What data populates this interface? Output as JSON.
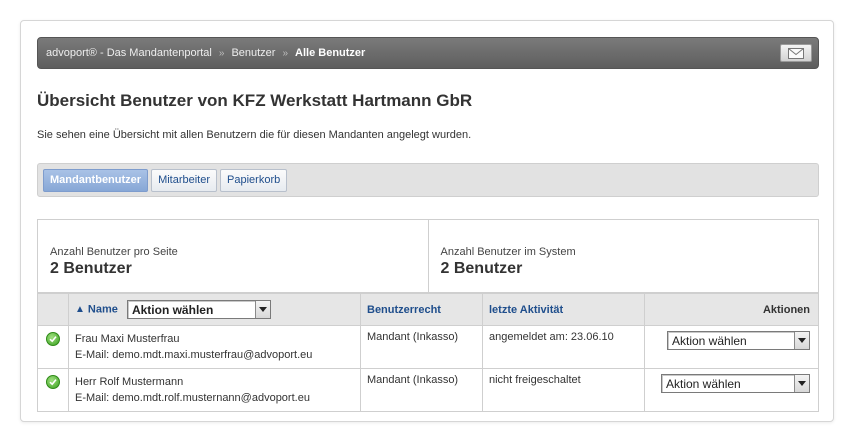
{
  "breadcrumb": {
    "items": [
      "advoport® - Das Mandantenportal",
      "Benutzer",
      "Alle Benutzer"
    ],
    "separator": "»"
  },
  "page": {
    "title": "Übersicht Benutzer von KFZ Werkstatt Hartmann GbR",
    "intro": "Sie sehen eine Übersicht mit allen Benutzern die für diesen Mandanten angelegt wurden."
  },
  "tabs": [
    {
      "label": "Mandantbenutzer",
      "active": true
    },
    {
      "label": "Mitarbeiter",
      "active": false
    },
    {
      "label": "Papierkorb",
      "active": false
    }
  ],
  "stats": {
    "per_page_label": "Anzahl Benutzer pro Seite",
    "per_page_value": "2 Benutzer",
    "in_system_label": "Anzahl Benutzer im System",
    "in_system_value": "2 Benutzer"
  },
  "table": {
    "headers": {
      "name": "Name",
      "name_select": "Aktion wählen",
      "right": "Benutzerrecht",
      "activity": "letzte Aktivität",
      "actions": "Aktionen"
    },
    "rows": [
      {
        "name": "Frau Maxi Musterfrau",
        "email": "E-Mail: demo.mdt.maxi.musterfrau@advoport.eu",
        "right": "Mandant (Inkasso)",
        "activity": "angemeldet am: 23.06.10",
        "action": "Aktion wählen"
      },
      {
        "name": "Herr Rolf Mustermann",
        "email": "E-Mail: demo.mdt.rolf.musternann@advoport.eu",
        "right": "Mandant (Inkasso)",
        "activity": "nicht freigeschaltet",
        "action": "Aktion wählen"
      }
    ]
  },
  "icons": {
    "mail": "mail-icon",
    "status": "check-circle-icon",
    "sort": "sort-up-icon"
  },
  "colors": {
    "link": "#1f4e8c",
    "active_tab": "#87a7d6",
    "crumbbar": "#6b6b6b",
    "status_ok": "#3aa020"
  }
}
